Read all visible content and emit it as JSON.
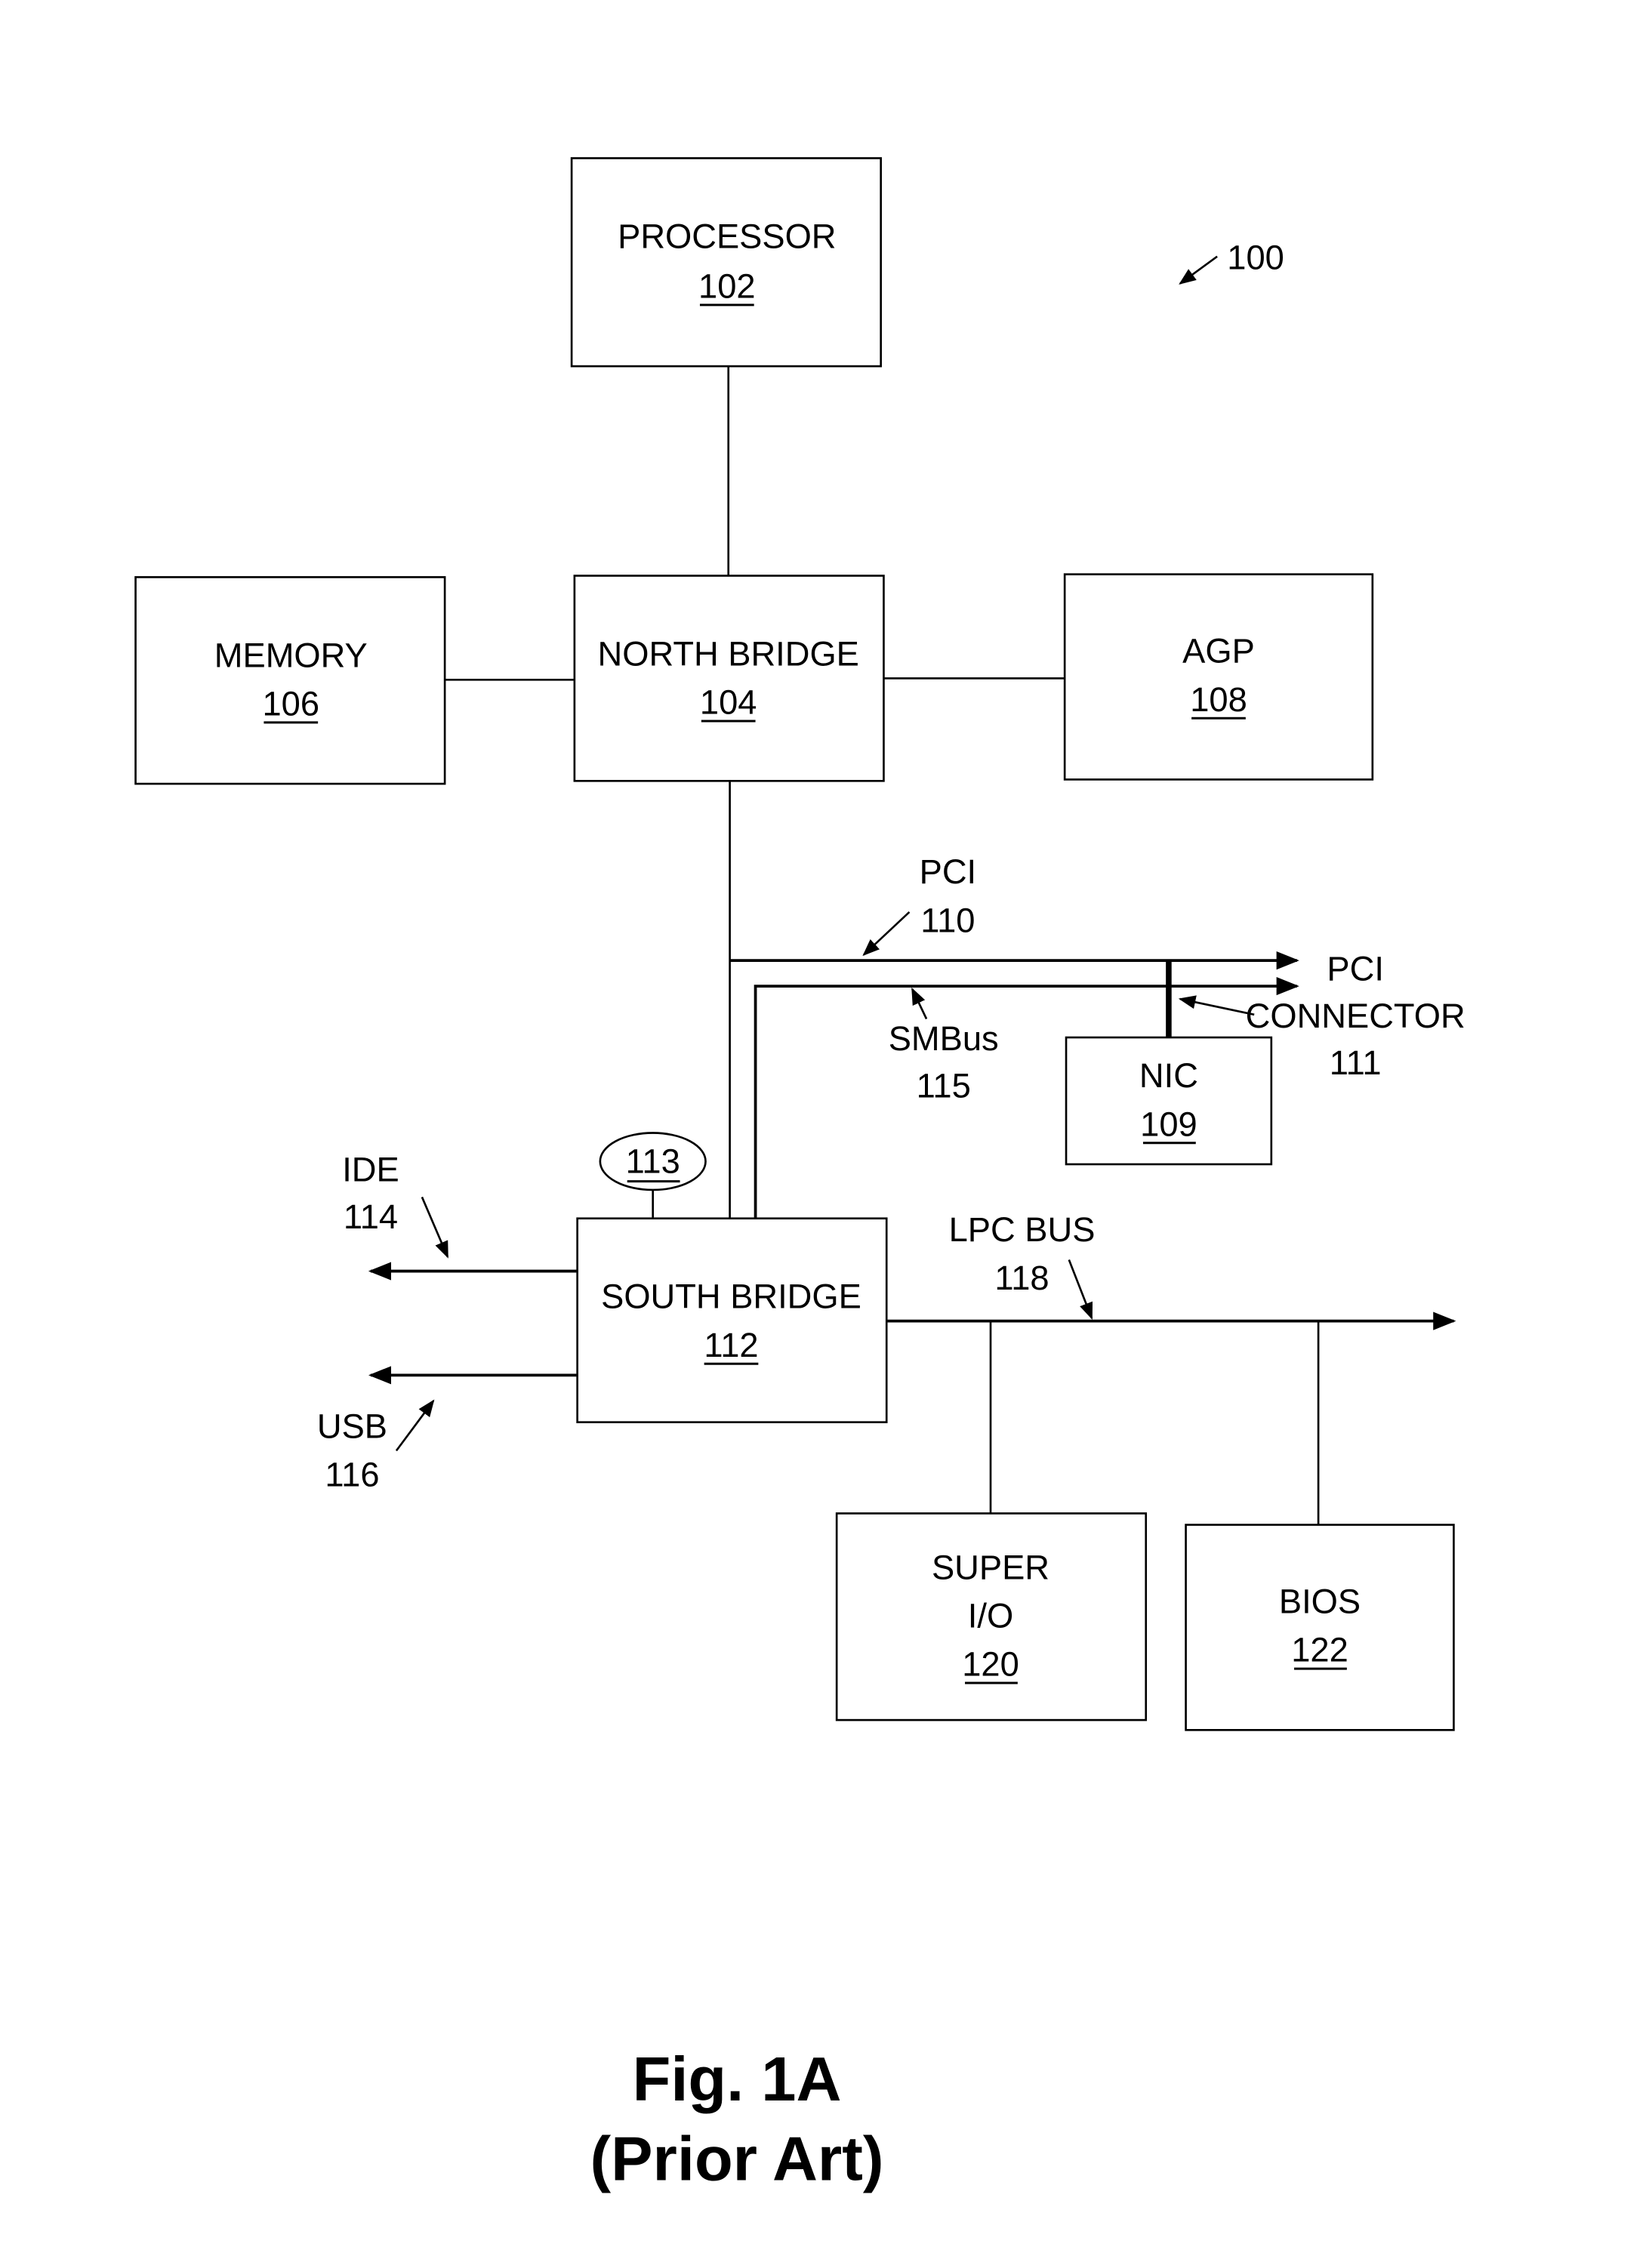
{
  "figure": {
    "caption_line1": "Fig. 1A",
    "caption_line2": "(Prior Art)",
    "system_ref": "100"
  },
  "blocks": {
    "processor": {
      "label": "PROCESSOR",
      "ref": "102"
    },
    "north_bridge": {
      "label": "NORTH BRIDGE",
      "ref": "104"
    },
    "memory": {
      "label": "MEMORY",
      "ref": "106"
    },
    "agp": {
      "label": "AGP",
      "ref": "108"
    },
    "nic": {
      "label": "NIC",
      "ref": "109"
    },
    "south_bridge": {
      "label": "SOUTH BRIDGE",
      "ref": "112"
    },
    "oval": {
      "ref": "113"
    },
    "super_io": {
      "label_line1": "SUPER",
      "label_line2": "I/O",
      "ref": "120"
    },
    "bios": {
      "label": "BIOS",
      "ref": "122"
    }
  },
  "buses": {
    "pci": {
      "label": "PCI",
      "ref": "110"
    },
    "pci_connector": {
      "label_line1": "PCI",
      "label_line2": "CONNECTOR",
      "ref": "111"
    },
    "smbus": {
      "label": "SMBus",
      "ref": "115"
    },
    "ide": {
      "label": "IDE",
      "ref": "114"
    },
    "usb": {
      "label": "USB",
      "ref": "116"
    },
    "lpc": {
      "label": "LPC BUS",
      "ref": "118"
    }
  }
}
